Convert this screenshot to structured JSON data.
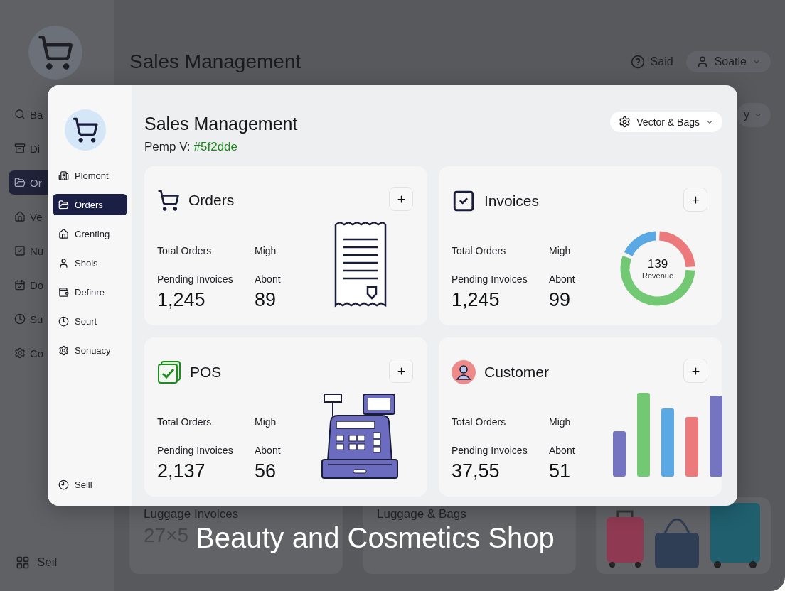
{
  "background": {
    "sidebar": {
      "items": [
        {
          "label": "Ba",
          "selected": false
        },
        {
          "label": "Di",
          "selected": false
        },
        {
          "label": "Or",
          "selected": true
        },
        {
          "label": "Ve",
          "selected": false
        },
        {
          "label": "Nu",
          "selected": false
        },
        {
          "label": "Do",
          "selected": false
        },
        {
          "label": "Su",
          "selected": false
        },
        {
          "label": "Co",
          "selected": false
        }
      ],
      "footer": "Seil"
    },
    "header": {
      "title": "Sales Management",
      "help": "Said",
      "user": "Soatle",
      "range": "y"
    },
    "cards": [
      {
        "title": "Luggage Invoices",
        "value": "27×5"
      },
      {
        "title": "Luggage & Bags"
      }
    ]
  },
  "modal": {
    "nav": [
      {
        "label": "Plomont",
        "selected": false
      },
      {
        "label": "Orders",
        "selected": true
      },
      {
        "label": "Crenting",
        "selected": false
      },
      {
        "label": "Shols",
        "selected": false
      },
      {
        "label": "Definre",
        "selected": false
      },
      {
        "label": "Sourt",
        "selected": false
      },
      {
        "label": "Sonuacy",
        "selected": false
      }
    ],
    "footer": "Seill",
    "title": "Sales Management",
    "subtitle_label": "Pemp V:",
    "subtitle_value": "#5f2dde",
    "filter": "Vector & Bags",
    "cards": [
      {
        "kind": "receipt",
        "title": "Orders",
        "labels": [
          "Total Orders",
          "Migh",
          "Pending Invoices",
          "Abont"
        ],
        "values": [
          "1,245",
          "89"
        ]
      },
      {
        "kind": "donut",
        "title": "Invoices",
        "labels": [
          "Total Orders",
          "Migh",
          "Pending Invoices",
          "Abont"
        ],
        "values": [
          "1,245",
          "99"
        ],
        "center_value": "139",
        "center_label": "Revenue"
      },
      {
        "kind": "register",
        "title": "POS",
        "labels": [
          "Total Orders",
          "Migh",
          "Pending Invoices",
          "Abont"
        ],
        "values": [
          "2,137",
          "56"
        ]
      },
      {
        "kind": "bars",
        "title": "Customer",
        "labels": [
          "Total Orders",
          "Migh",
          "Pending Invoices",
          "Abont"
        ],
        "values": [
          "37,55",
          "51"
        ]
      }
    ]
  },
  "caption": "Beauty and Cosmetics Shop"
}
